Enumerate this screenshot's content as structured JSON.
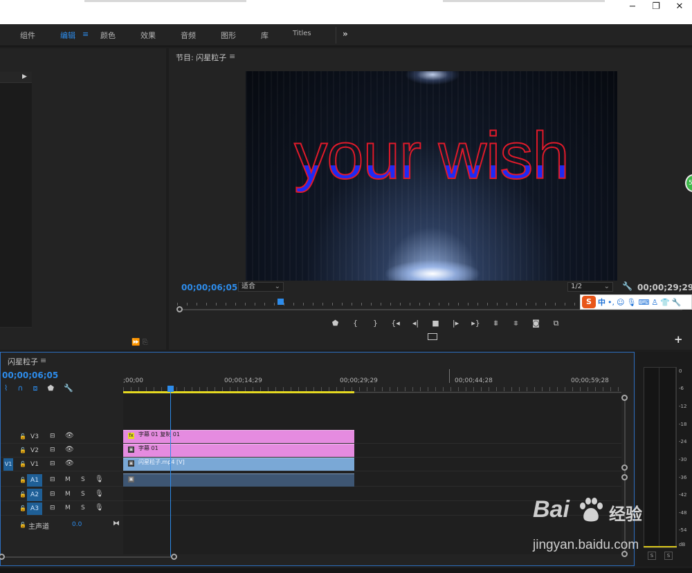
{
  "workspace": {
    "tabs": [
      {
        "label": "组件",
        "active": false
      },
      {
        "label": "编辑",
        "active": true
      },
      {
        "label": "颜色",
        "active": false
      },
      {
        "label": "效果",
        "active": false
      },
      {
        "label": "音频",
        "active": false
      },
      {
        "label": "图形",
        "active": false
      },
      {
        "label": "库",
        "active": false
      },
      {
        "label": "Titles",
        "active": false
      }
    ],
    "menu_glyph": "≡",
    "more_glyph": "»"
  },
  "window_controls": {
    "minimize": "−",
    "restore": "❐",
    "close": "✕"
  },
  "program_monitor": {
    "title": "节目: 闪星粒子",
    "menu_glyph": "≡",
    "preview_text": "your wish",
    "current_timecode": "00;00;06;05",
    "fit_label": "适合",
    "resolution_label": "1/2",
    "duration_timecode": "00;00;29;29",
    "transport_icons": [
      "marker-icon",
      "mark-in-icon",
      "mark-out-icon",
      "go-to-in-icon",
      "step-back-icon",
      "stop-icon",
      "step-forward-icon",
      "go-to-out-icon",
      "lift-icon",
      "extract-icon",
      "export-frame-icon",
      "compare-icon"
    ]
  },
  "ime_toolbar": {
    "logo": "S",
    "lang": "中"
  },
  "timeline": {
    "title": "闪星粒子",
    "menu_glyph": "≡",
    "timecode": "00;00;06;05",
    "ruler_labels": [
      ";00;00",
      "00;00;14;29",
      "00;00;29;29",
      "00;00;44;28",
      "00;00;59;28"
    ],
    "video_tracks": [
      {
        "name": "V3",
        "clip": "字幕 01 复制 01",
        "clip_icon": "fx",
        "targeted": false
      },
      {
        "name": "V2",
        "clip": "字幕 01",
        "clip_icon": "▣",
        "targeted": false
      },
      {
        "name": "V1",
        "clip": "闪星粒子.mp4 [V]",
        "clip_icon": "▣",
        "targeted": true,
        "source": "V1"
      }
    ],
    "audio_tracks": [
      {
        "name": "A1",
        "targeted": true,
        "mute": "M",
        "solo": "S"
      },
      {
        "name": "A2",
        "targeted": true,
        "mute": "M",
        "solo": "S"
      },
      {
        "name": "A3",
        "targeted": true,
        "mute": "M",
        "solo": "S"
      }
    ],
    "master": {
      "label": "主声道",
      "value": "0.0"
    }
  },
  "audio_meter": {
    "db_labels": [
      "0",
      "-6",
      "-12",
      "-18",
      "-24",
      "-30",
      "-36",
      "-42",
      "-48",
      "-54",
      "dB"
    ],
    "solo_labels": [
      "S",
      "S"
    ]
  },
  "watermark": {
    "brand_left": "Bai",
    "brand_right": "经验",
    "url": "jingyan.baidu.com"
  },
  "colors": {
    "accent": "#2d8ceb",
    "title_clip": "#e58be0",
    "video_clip": "#7aa8d6",
    "audio_clip": "#3e5673",
    "work_area": "#e5d920"
  }
}
